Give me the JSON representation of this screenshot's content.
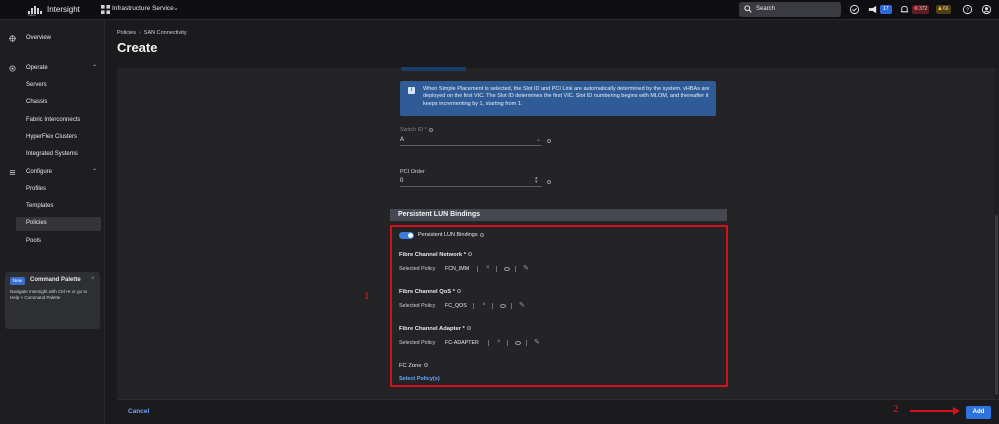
{
  "topbar": {
    "brand": "Intersight",
    "logo_text": "cisco",
    "service": "Infrastructure Service",
    "search_placeholder": "Search",
    "notif_count": "17",
    "alarm_critical": "372",
    "alarm_warning": "66"
  },
  "sidebar": {
    "overview": "Overview",
    "operate": "Operate",
    "operate_items": [
      "Servers",
      "Chassis",
      "Fabric Interconnects",
      "HyperFlex Clusters",
      "Integrated Systems"
    ],
    "configure": "Configure",
    "configure_items": [
      "Profiles",
      "Templates",
      "Policies",
      "Pools"
    ],
    "active_item": "Policies",
    "palette": {
      "badge": "New",
      "title": "Command Palette",
      "close": "×",
      "description": "Navigate Intersight with Ctrl+K or go to Help > Command Palette"
    }
  },
  "header": {
    "breadcrumb": [
      "Policies",
      "SAN Connectivity"
    ],
    "title": "Create"
  },
  "form": {
    "info_text": "When Simple Placement is selected, the Slot ID and PCI Link are automatically determined by the system. vHBAs are deployed on the first VIC. The Slot ID determines the first VIC. Slot ID numbering begins with MLOM, and thereafter it keeps incrementing by 1, starting from 1.",
    "switch_id_label": "Switch ID *",
    "switch_id_value": "A",
    "pci_order_label": "PCI Order",
    "pci_order_value": "0",
    "section_title": "Persistent LUN Bindings",
    "toggle_label": "Persistent LUN Bindings",
    "toggle_on": true,
    "policies": [
      {
        "title": "Fibre Channel Network *",
        "selected_label": "Selected Policy",
        "value": "FCN_IMM"
      },
      {
        "title": "Fibre Channel QoS *",
        "selected_label": "Selected Policy",
        "value": "FC_QOS"
      },
      {
        "title": "Fibre Channel Adapter *",
        "selected_label": "Selected Policy",
        "value": "FC-ADAPTER"
      }
    ],
    "fc_zone_label": "FC Zone",
    "fc_zone_link": "Select Policy(s)"
  },
  "footer": {
    "cancel": "Cancel",
    "add": "Add"
  },
  "annotations": {
    "one": "1",
    "two": "2"
  },
  "colors": {
    "accent": "#2f74de",
    "link": "#6aa6ff",
    "highlight_box": "#d4101c",
    "info_bg": "#2f5c97"
  }
}
